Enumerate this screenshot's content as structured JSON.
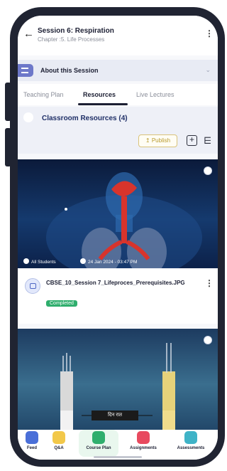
{
  "header": {
    "title": "Session 6: Respiration",
    "subtitle": "Chapter :5. Life Processes"
  },
  "about": {
    "label": "About this Session"
  },
  "tabs": [
    {
      "label": "Teaching Plan"
    },
    {
      "label": "Resources",
      "active": true
    },
    {
      "label": "Live Lectures"
    }
  ],
  "resources": {
    "title": "Classroom Resources (4)",
    "publish_label": "↥ Publish",
    "add_glyph": "+",
    "filter_glyph": "⋿"
  },
  "card1": {
    "audience": "All Students",
    "datetime": "24 Jan 2024 - 03:47 PM",
    "file_name": "CBSE_10_Session 7_Lifeproces_Prerequisites.JPG",
    "status": "Completed"
  },
  "card2": {
    "overlay_text": "दिन रात"
  },
  "bottom_nav": [
    {
      "label": "Feed",
      "color": "#4a6fd8",
      "icon": "feed-icon"
    },
    {
      "label": "Q&A",
      "color": "#f2c84a",
      "icon": "qa-icon"
    },
    {
      "label": "Course Plan",
      "color": "#2fae6d",
      "icon": "course-plan-icon",
      "active": true
    },
    {
      "label": "Assignments",
      "color": "#e84a5f",
      "icon": "assignments-icon"
    },
    {
      "label": "Assessments",
      "color": "#3fb3c7",
      "icon": "assessments-icon"
    }
  ],
  "colors": {
    "frame": "#202432",
    "accent": "#1f2f67",
    "completed": "#2fae6d",
    "about_chip": "#6d78c9"
  }
}
